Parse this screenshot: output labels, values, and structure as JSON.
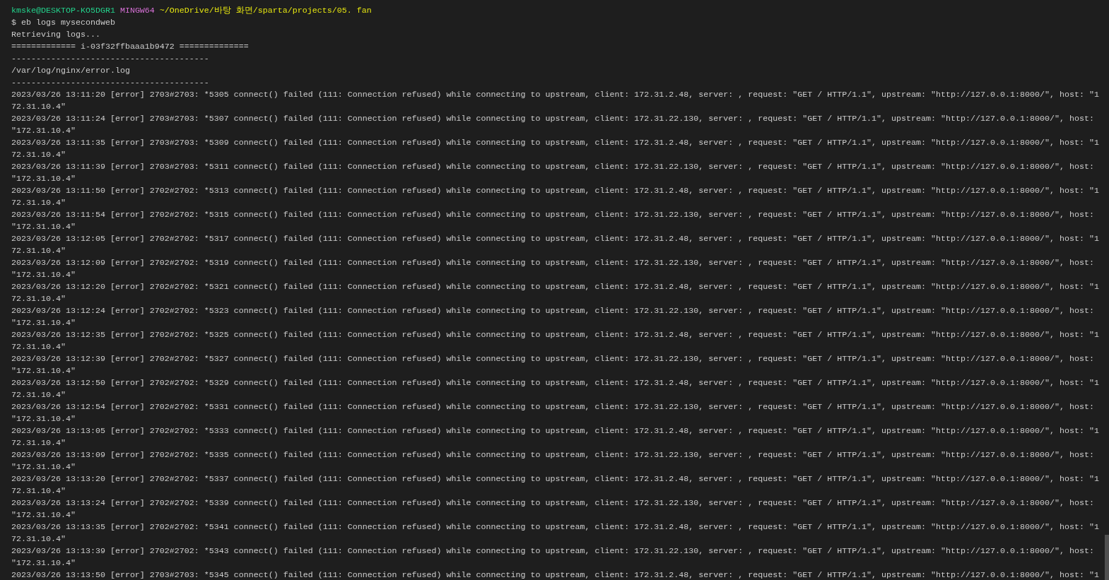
{
  "prompt": {
    "user_host": "kmske@DESKTOP-KO5DGR1",
    "shell": "MINGW64",
    "path": "~/OneDrive/바탕 화면/sparta/projects/05. fan"
  },
  "command": "$ eb logs mysecondweb",
  "output": [
    "Retrieving logs...",
    "============= i-03f32ffbaaa1b9472 ==============",
    "----------------------------------------",
    "/var/log/nginx/error.log",
    "----------------------------------------"
  ],
  "log_lines": [
    "2023/03/26 13:11:20 [error] 2703#2703: *5305 connect() failed (111: Connection refused) while connecting to upstream, client: 172.31.2.48, server: , request: \"GET / HTTP/1.1\", upstream: \"http://127.0.0.1:8000/\", host: \"172.31.10.4\"",
    "2023/03/26 13:11:24 [error] 2703#2703: *5307 connect() failed (111: Connection refused) while connecting to upstream, client: 172.31.22.130, server: , request: \"GET / HTTP/1.1\", upstream: \"http://127.0.0.1:8000/\", host: \"172.31.10.4\"",
    "2023/03/26 13:11:35 [error] 2703#2703: *5309 connect() failed (111: Connection refused) while connecting to upstream, client: 172.31.2.48, server: , request: \"GET / HTTP/1.1\", upstream: \"http://127.0.0.1:8000/\", host: \"172.31.10.4\"",
    "2023/03/26 13:11:39 [error] 2703#2703: *5311 connect() failed (111: Connection refused) while connecting to upstream, client: 172.31.22.130, server: , request: \"GET / HTTP/1.1\", upstream: \"http://127.0.0.1:8000/\", host: \"172.31.10.4\"",
    "2023/03/26 13:11:50 [error] 2702#2702: *5313 connect() failed (111: Connection refused) while connecting to upstream, client: 172.31.2.48, server: , request: \"GET / HTTP/1.1\", upstream: \"http://127.0.0.1:8000/\", host: \"172.31.10.4\"",
    "2023/03/26 13:11:54 [error] 2702#2702: *5315 connect() failed (111: Connection refused) while connecting to upstream, client: 172.31.22.130, server: , request: \"GET / HTTP/1.1\", upstream: \"http://127.0.0.1:8000/\", host: \"172.31.10.4\"",
    "2023/03/26 13:12:05 [error] 2702#2702: *5317 connect() failed (111: Connection refused) while connecting to upstream, client: 172.31.2.48, server: , request: \"GET / HTTP/1.1\", upstream: \"http://127.0.0.1:8000/\", host: \"172.31.10.4\"",
    "2023/03/26 13:12:09 [error] 2702#2702: *5319 connect() failed (111: Connection refused) while connecting to upstream, client: 172.31.22.130, server: , request: \"GET / HTTP/1.1\", upstream: \"http://127.0.0.1:8000/\", host: \"172.31.10.4\"",
    "2023/03/26 13:12:20 [error] 2702#2702: *5321 connect() failed (111: Connection refused) while connecting to upstream, client: 172.31.2.48, server: , request: \"GET / HTTP/1.1\", upstream: \"http://127.0.0.1:8000/\", host: \"172.31.10.4\"",
    "2023/03/26 13:12:24 [error] 2702#2702: *5323 connect() failed (111: Connection refused) while connecting to upstream, client: 172.31.22.130, server: , request: \"GET / HTTP/1.1\", upstream: \"http://127.0.0.1:8000/\", host: \"172.31.10.4\"",
    "2023/03/26 13:12:35 [error] 2702#2702: *5325 connect() failed (111: Connection refused) while connecting to upstream, client: 172.31.2.48, server: , request: \"GET / HTTP/1.1\", upstream: \"http://127.0.0.1:8000/\", host: \"172.31.10.4\"",
    "2023/03/26 13:12:39 [error] 2702#2702: *5327 connect() failed (111: Connection refused) while connecting to upstream, client: 172.31.22.130, server: , request: \"GET / HTTP/1.1\", upstream: \"http://127.0.0.1:8000/\", host: \"172.31.10.4\"",
    "2023/03/26 13:12:50 [error] 2702#2702: *5329 connect() failed (111: Connection refused) while connecting to upstream, client: 172.31.2.48, server: , request: \"GET / HTTP/1.1\", upstream: \"http://127.0.0.1:8000/\", host: \"172.31.10.4\"",
    "2023/03/26 13:12:54 [error] 2702#2702: *5331 connect() failed (111: Connection refused) while connecting to upstream, client: 172.31.22.130, server: , request: \"GET / HTTP/1.1\", upstream: \"http://127.0.0.1:8000/\", host: \"172.31.10.4\"",
    "2023/03/26 13:13:05 [error] 2702#2702: *5333 connect() failed (111: Connection refused) while connecting to upstream, client: 172.31.2.48, server: , request: \"GET / HTTP/1.1\", upstream: \"http://127.0.0.1:8000/\", host: \"172.31.10.4\"",
    "2023/03/26 13:13:09 [error] 2702#2702: *5335 connect() failed (111: Connection refused) while connecting to upstream, client: 172.31.22.130, server: , request: \"GET / HTTP/1.1\", upstream: \"http://127.0.0.1:8000/\", host: \"172.31.10.4\"",
    "2023/03/26 13:13:20 [error] 2702#2702: *5337 connect() failed (111: Connection refused) while connecting to upstream, client: 172.31.2.48, server: , request: \"GET / HTTP/1.1\", upstream: \"http://127.0.0.1:8000/\", host: \"172.31.10.4\"",
    "2023/03/26 13:13:24 [error] 2702#2702: *5339 connect() failed (111: Connection refused) while connecting to upstream, client: 172.31.22.130, server: , request: \"GET / HTTP/1.1\", upstream: \"http://127.0.0.1:8000/\", host: \"172.31.10.4\"",
    "2023/03/26 13:13:35 [error] 2702#2702: *5341 connect() failed (111: Connection refused) while connecting to upstream, client: 172.31.2.48, server: , request: \"GET / HTTP/1.1\", upstream: \"http://127.0.0.1:8000/\", host: \"172.31.10.4\"",
    "2023/03/26 13:13:39 [error] 2702#2702: *5343 connect() failed (111: Connection refused) while connecting to upstream, client: 172.31.22.130, server: , request: \"GET / HTTP/1.1\", upstream: \"http://127.0.0.1:8000/\", host: \"172.31.10.4\"",
    "2023/03/26 13:13:50 [error] 2703#2703: *5345 connect() failed (111: Connection refused) while connecting to upstream, client: 172.31.2.48, server: , request: \"GET / HTTP/1.1\", upstream: \"http://127.0.0.1:8000/\", host: \"1"
  ]
}
